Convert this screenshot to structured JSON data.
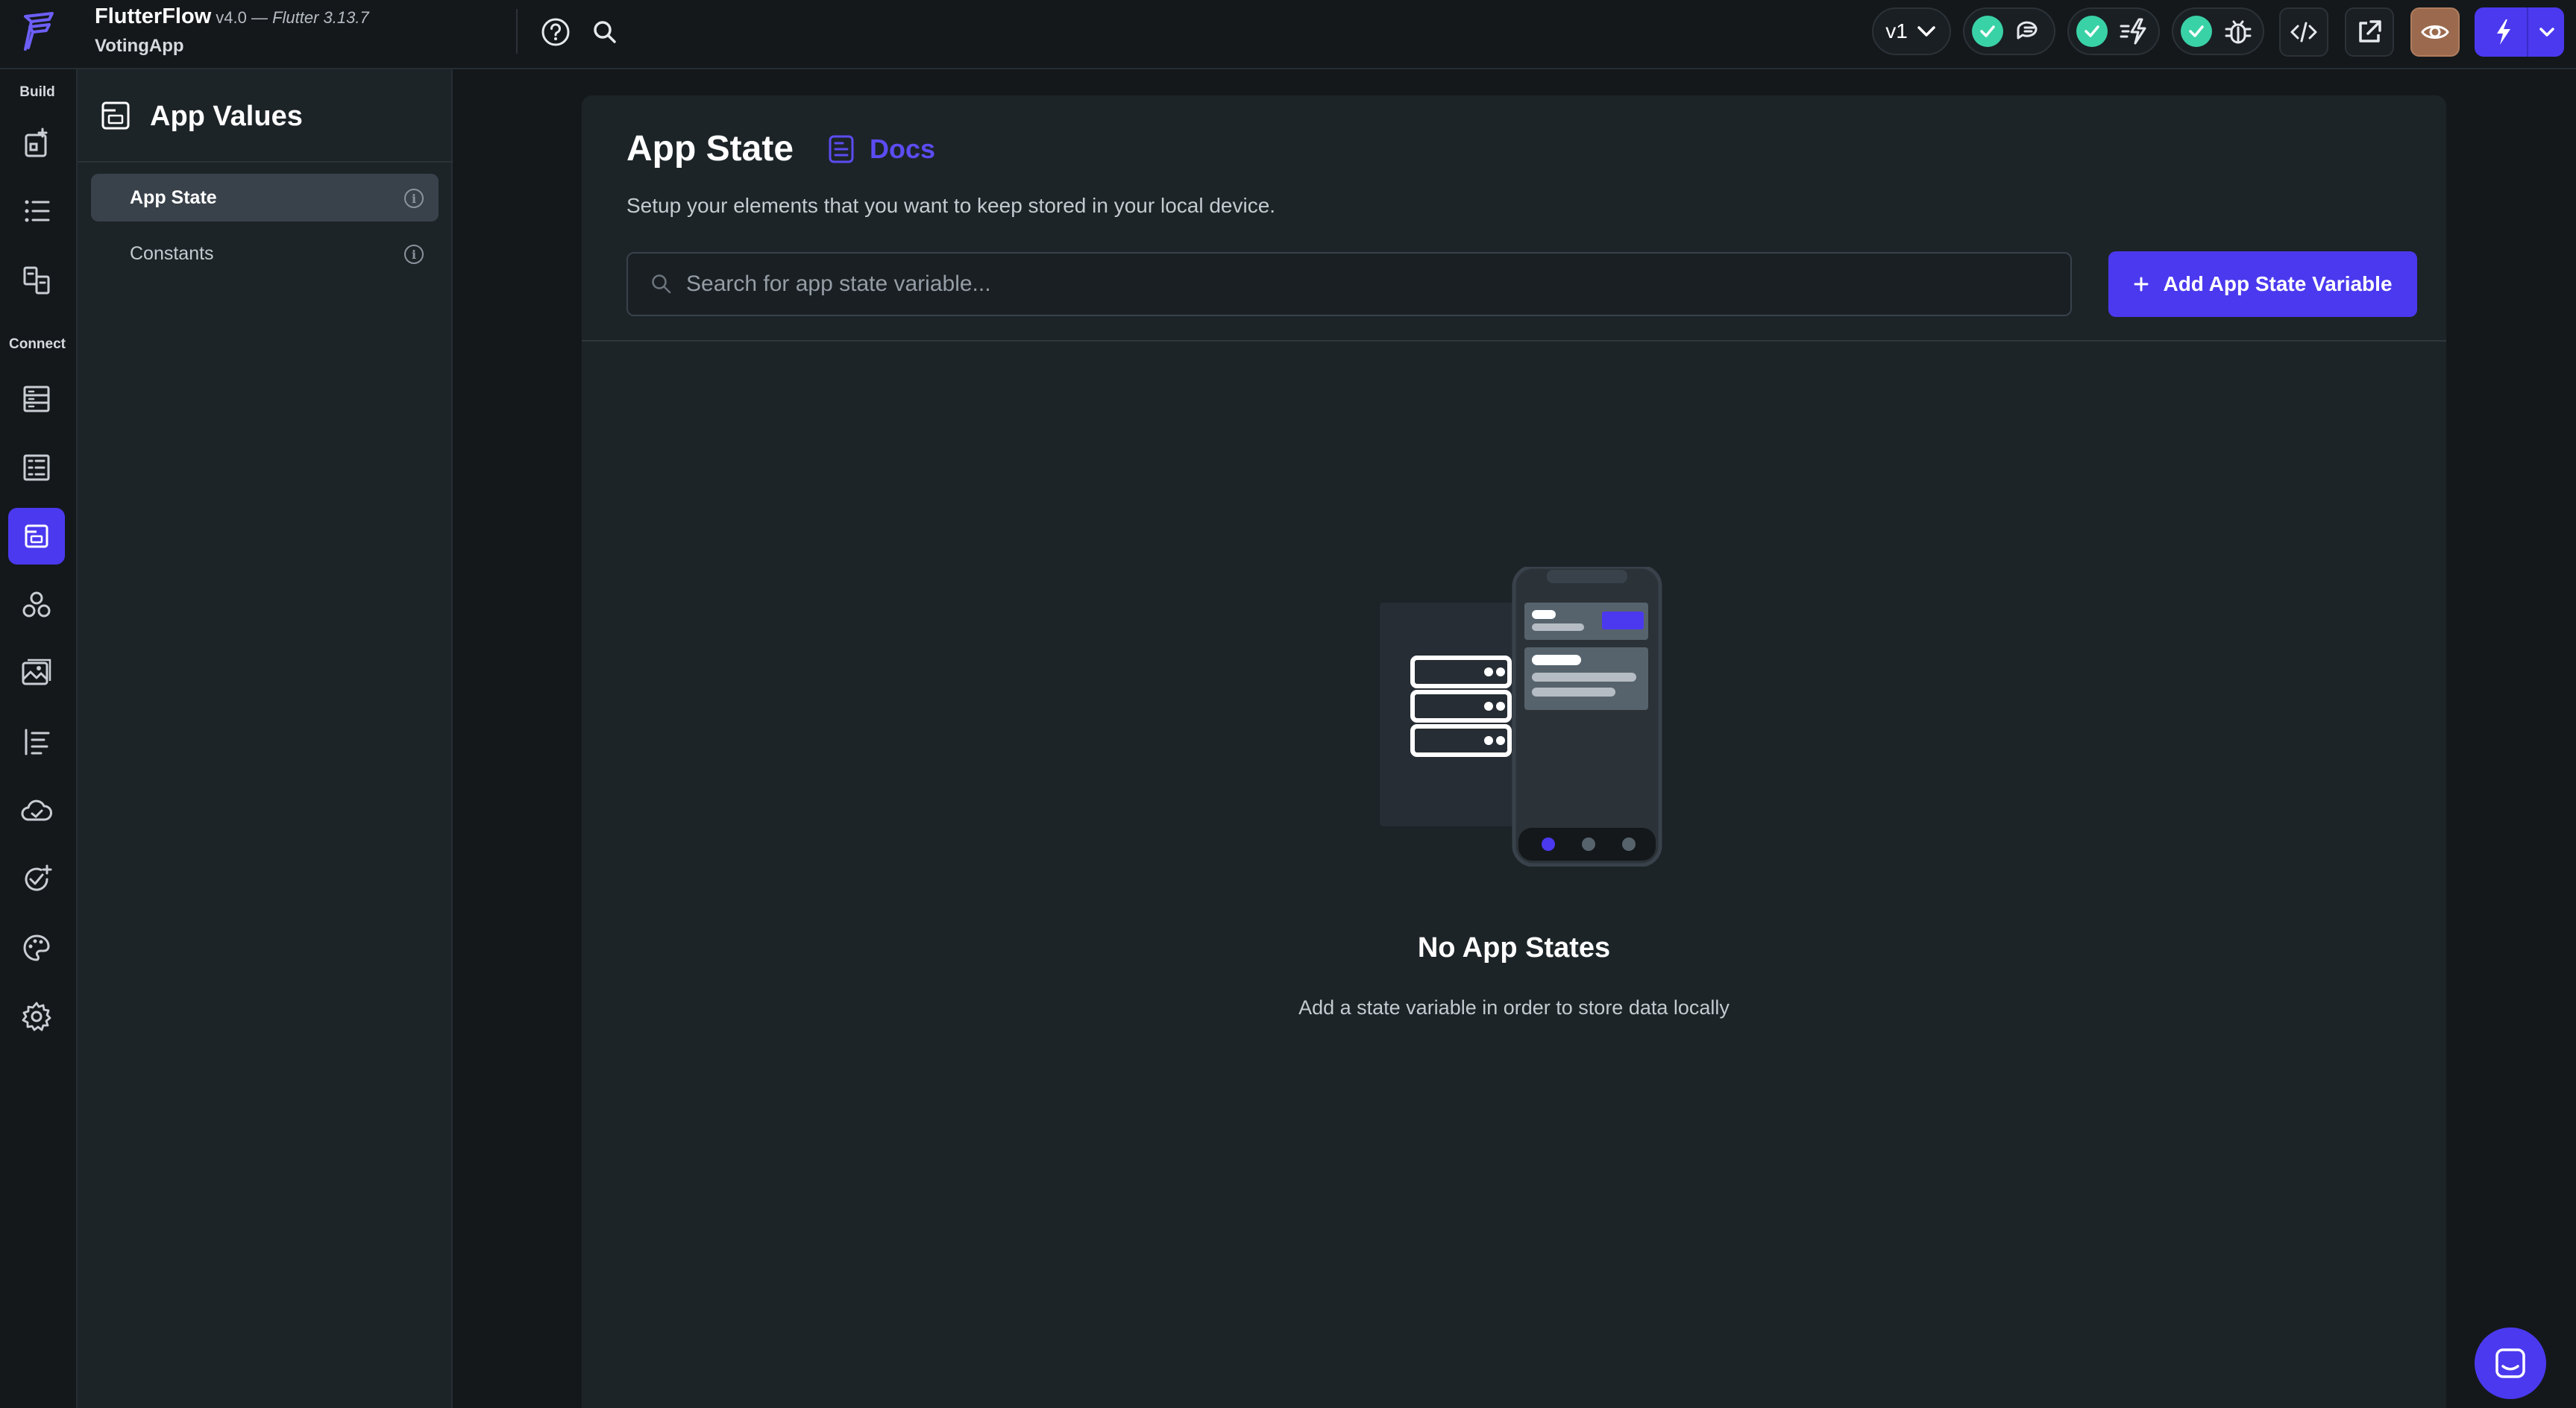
{
  "topbar": {
    "brand": "FlutterFlow",
    "version": "v4.0 —",
    "flutter_version": "Flutter 3.13.7",
    "project": "VotingApp",
    "branch_label": "v1",
    "icons": [
      "flutterflow-logo-icon",
      "help-icon",
      "search-icon",
      "chevron-down-icon",
      "check-icon",
      "comments-icon",
      "check-icon",
      "lightning-icon",
      "check-icon",
      "bug-icon",
      "code-icon",
      "open-external-icon",
      "eye-icon",
      "lightning-icon",
      "chevron-down-icon"
    ]
  },
  "rail": {
    "build_label": "Build",
    "connect_label": "Connect",
    "items": [
      "add-page-icon",
      "list-icon",
      "page-copy-icon",
      "storage-icon",
      "doc-list-icon",
      "app-values-icon",
      "community-icon",
      "media-icon",
      "text-list-icon",
      "cloud-icon",
      "check-add-icon",
      "theme-icon",
      "settings-icon"
    ],
    "active_item": "app-values-icon"
  },
  "panel": {
    "title": "App Values",
    "items": [
      {
        "label": "App State",
        "active": true
      },
      {
        "label": "Constants",
        "active": false
      }
    ]
  },
  "main": {
    "title": "App State",
    "docs_label": "Docs",
    "subtitle": "Setup your elements that you want to keep stored in your local device.",
    "search_placeholder": "Search for app state variable...",
    "add_button_label": "Add App State Variable",
    "empty_title": "No App States",
    "empty_subtitle": "Add a state variable in order to store data locally"
  },
  "colors": {
    "accent": "#4b39ef",
    "success": "#39d2a6",
    "background": "#14181b",
    "surface": "#1d2428",
    "preview_button": "#9b6a4e"
  }
}
